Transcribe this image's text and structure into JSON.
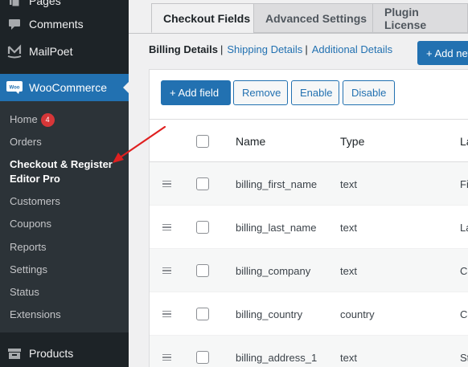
{
  "sidebar": {
    "pages_label": "Pages",
    "comments_label": "Comments",
    "mailpoet_label": "MailPoet",
    "woocommerce_label": "WooCommerce",
    "woo_logo_text": "Woo",
    "submenu": [
      {
        "label": "Home",
        "badge": "4"
      },
      {
        "label": "Orders"
      },
      {
        "label": "Checkout & Register Editor Pro",
        "current": true
      },
      {
        "label": "Customers"
      },
      {
        "label": "Coupons"
      },
      {
        "label": "Reports"
      },
      {
        "label": "Settings"
      },
      {
        "label": "Status"
      },
      {
        "label": "Extensions"
      }
    ],
    "products_label": "Products"
  },
  "tabs": [
    {
      "label": "Checkout Fields",
      "active": true
    },
    {
      "label": "Advanced Settings",
      "active": false
    },
    {
      "label": "Plugin License",
      "active": false
    }
  ],
  "subnav": {
    "current": "Billing Details",
    "links": [
      "Shipping Details",
      "Additional Details"
    ],
    "separator": "|"
  },
  "add_new_label": "+ Add new",
  "toolbar": {
    "add_field": "+ Add field",
    "remove": "Remove",
    "enable": "Enable",
    "disable": "Disable"
  },
  "table": {
    "headers": {
      "name": "Name",
      "type": "Type",
      "label": "La"
    },
    "rows": [
      {
        "name": "billing_first_name",
        "type": "text",
        "label": "Fi"
      },
      {
        "name": "billing_last_name",
        "type": "text",
        "label": "La"
      },
      {
        "name": "billing_company",
        "type": "text",
        "label": "Co"
      },
      {
        "name": "billing_country",
        "type": "country",
        "label": "Co"
      },
      {
        "name": "billing_address_1",
        "type": "text",
        "label": "St"
      }
    ]
  },
  "annotation": {
    "arrow_color": "#e02020"
  },
  "colors": {
    "admin_bar": "#1d2327",
    "accent": "#2271b1",
    "badge": "#d63638"
  },
  "icons": [
    "pages-icon",
    "comments-icon",
    "mailpoet-icon",
    "woocommerce-icon",
    "products-icon",
    "drag-handle-icon"
  ]
}
